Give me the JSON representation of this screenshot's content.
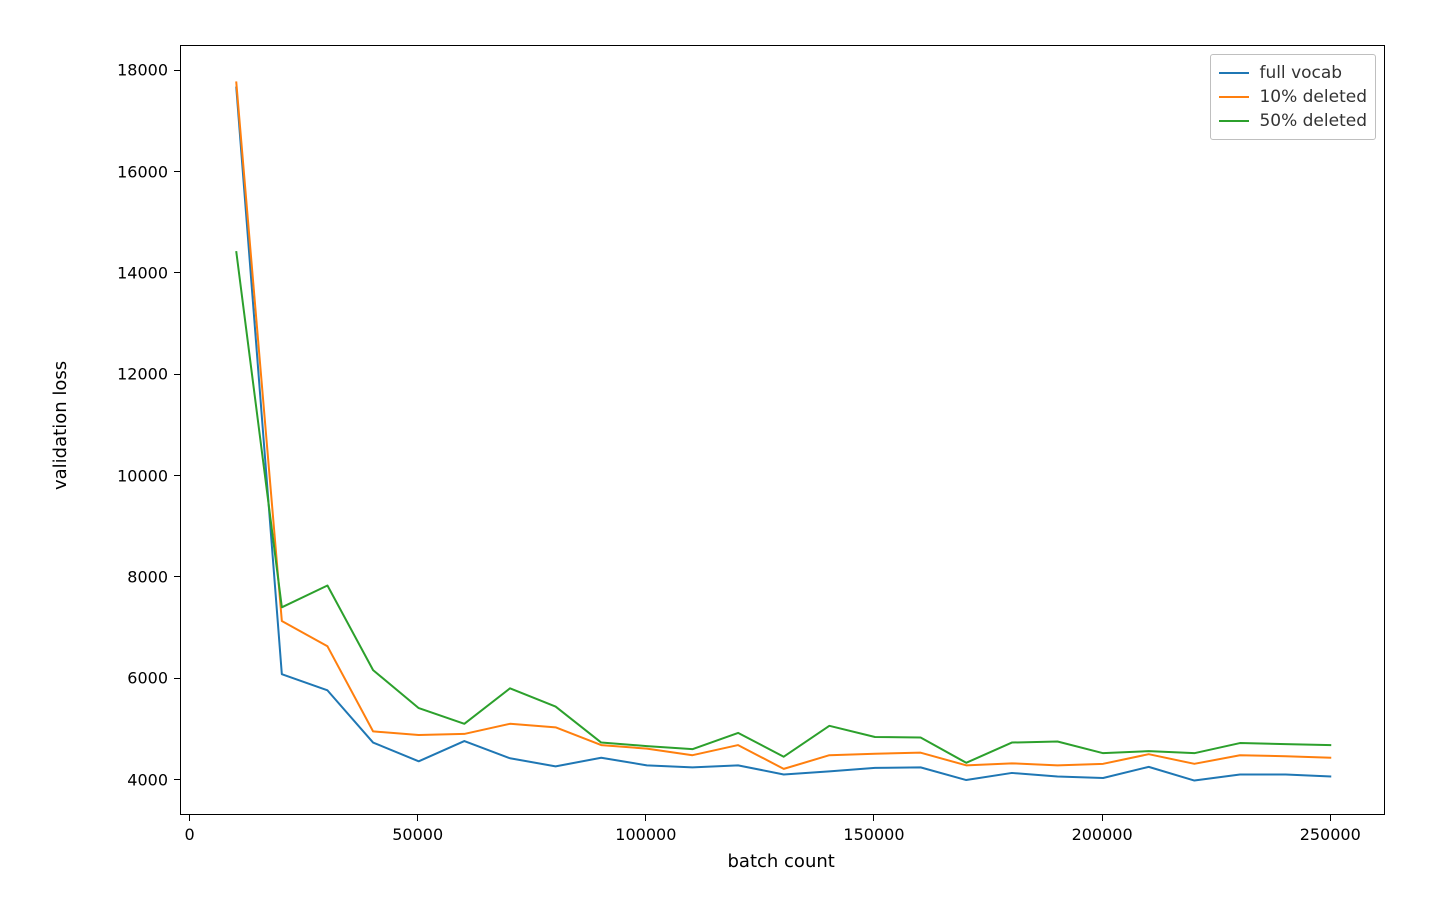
{
  "chart_data": {
    "type": "line",
    "xlabel": "batch count",
    "ylabel": "validation loss",
    "title": "",
    "legend_position": "upper right",
    "xlim": [
      -2100,
      262000
    ],
    "ylim": [
      3300,
      18500
    ],
    "x_ticks": [
      0,
      50000,
      100000,
      150000,
      200000,
      250000
    ],
    "y_ticks": [
      4000,
      6000,
      8000,
      10000,
      12000,
      14000,
      16000,
      18000
    ],
    "x": [
      10000,
      20000,
      30000,
      40000,
      50000,
      60000,
      70000,
      80000,
      90000,
      100000,
      110000,
      120000,
      130000,
      140000,
      150000,
      160000,
      170000,
      180000,
      190000,
      200000,
      210000,
      220000,
      230000,
      240000,
      250000
    ],
    "series": [
      {
        "name": "full vocab",
        "color": "#1f77b4",
        "values": [
          17700,
          6100,
          5780,
          4750,
          4380,
          4780,
          4440,
          4280,
          4450,
          4300,
          4260,
          4300,
          4120,
          4180,
          4250,
          4260,
          4010,
          4150,
          4080,
          4050,
          4270,
          4000,
          4120,
          4120,
          4080
        ]
      },
      {
        "name": "10% deleted",
        "color": "#ff7f0e",
        "values": [
          17800,
          7150,
          6650,
          4970,
          4900,
          4920,
          5120,
          5050,
          4700,
          4630,
          4500,
          4700,
          4230,
          4500,
          4530,
          4550,
          4300,
          4340,
          4300,
          4330,
          4520,
          4330,
          4500,
          4480,
          4450
        ]
      },
      {
        "name": "50% deleted",
        "color": "#2ca02c",
        "values": [
          14450,
          7420,
          7850,
          6180,
          5430,
          5120,
          5820,
          5460,
          4750,
          4680,
          4620,
          4940,
          4470,
          5080,
          4860,
          4850,
          4350,
          4750,
          4770,
          4540,
          4580,
          4540,
          4740,
          4720,
          4700
        ]
      }
    ]
  }
}
